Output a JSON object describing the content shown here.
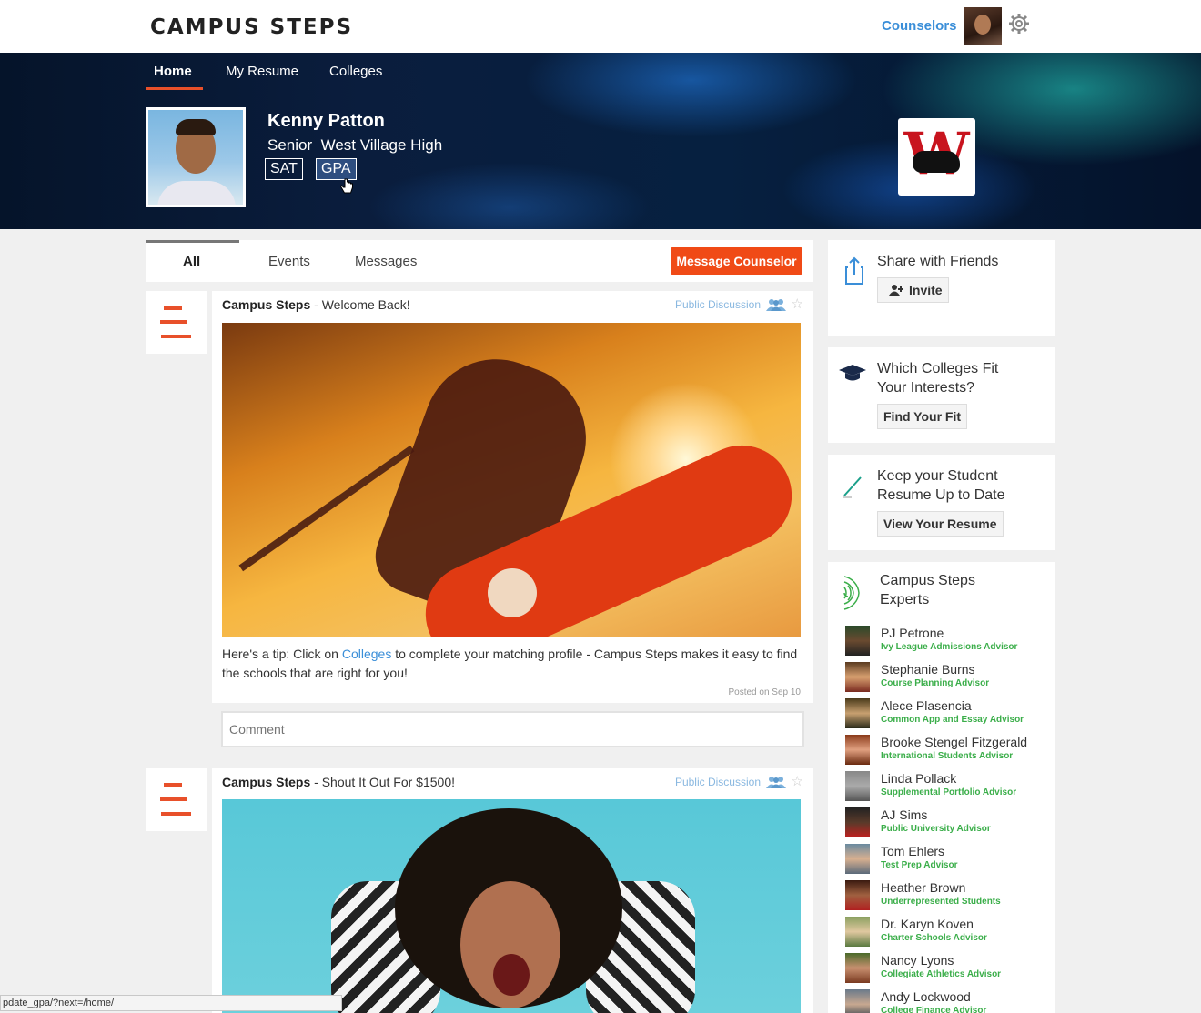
{
  "header": {
    "logo": "CAMPUS STEPS",
    "counselors_link": "Counselors"
  },
  "nav": {
    "tabs": [
      "Home",
      "My Resume",
      "Colleges"
    ]
  },
  "profile": {
    "name": "Kenny Patton",
    "grade": "Senior",
    "school": "West Village High",
    "tags": [
      "SAT",
      "GPA"
    ]
  },
  "feed": {
    "tabs": [
      "All",
      "Events",
      "Messages"
    ],
    "message_button": "Message Counselor",
    "posts": [
      {
        "author": "Campus Steps",
        "subject": " - Welcome Back!",
        "visibility": "Public Discussion",
        "text_before": "Here's a tip: Click on ",
        "link_text": "Colleges",
        "text_after": " to complete your matching profile - Campus Steps makes it easy to find the schools that are right for you!",
        "posted": "Posted on Sep 10",
        "comment_placeholder": "Comment"
      },
      {
        "author": "Campus Steps",
        "subject": " - Shout It Out For $1500!",
        "visibility": "Public Discussion"
      }
    ]
  },
  "sidebar": {
    "share": {
      "title": "Share with Friends",
      "button": "Invite"
    },
    "fit": {
      "title_line1": "Which Colleges Fit",
      "title_line2": "Your Interests?",
      "button": "Find Your Fit"
    },
    "resume": {
      "title_line1": "Keep your Student",
      "title_line2": "Resume Up to Date",
      "button": "View Your Resume"
    },
    "experts": {
      "title_line1": "Campus Steps",
      "title_line2": "Experts",
      "list": [
        {
          "name": "PJ Petrone",
          "role": "Ivy League Admissions Advisor"
        },
        {
          "name": "Stephanie Burns",
          "role": "Course Planning Advisor"
        },
        {
          "name": "Alece Plasencia",
          "role": "Common App and Essay Advisor"
        },
        {
          "name": "Brooke Stengel Fitzgerald",
          "role": "International Students Advisor"
        },
        {
          "name": "Linda Pollack",
          "role": "Supplemental Portfolio Advisor"
        },
        {
          "name": "AJ Sims",
          "role": "Public University Advisor"
        },
        {
          "name": "Tom Ehlers",
          "role": "Test Prep Advisor"
        },
        {
          "name": "Heather Brown",
          "role": "Underrepresented Students"
        },
        {
          "name": "Dr. Karyn Koven",
          "role": "Charter Schools Advisor"
        },
        {
          "name": "Nancy Lyons",
          "role": "Collegiate Athletics Advisor"
        },
        {
          "name": "Andy Lockwood",
          "role": "College Finance Advisor"
        }
      ]
    }
  },
  "status_bar": "pdate_gpa/?next=/home/",
  "icons": {
    "gear": "gear-icon",
    "share": "share-icon",
    "add_user": "add-user-icon",
    "grad_cap": "graduation-cap-icon",
    "pencil": "pencil-icon",
    "experts": "broadcast-icon",
    "group": "group-icon",
    "star": "star-icon",
    "cursor": "hand-cursor-icon"
  },
  "colors": {
    "accent": "#f04a16",
    "link": "#3a8ed8",
    "expert_role": "#3bae4a"
  }
}
